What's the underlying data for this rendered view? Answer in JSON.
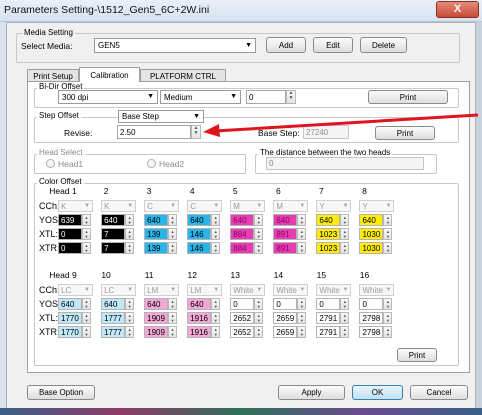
{
  "window": {
    "title": "Parameters Setting-\\1512_Gen5_6C+2W.ini",
    "close_glyph": "X"
  },
  "media_setting": {
    "group_title": "Media Setting",
    "select_label": "Select Media:",
    "selected": "GEN5",
    "buttons": [
      "Add",
      "Edit",
      "Delete"
    ]
  },
  "tabs": [
    {
      "label": "Print Setup",
      "active": false
    },
    {
      "label": "Calibration",
      "active": true
    },
    {
      "label": "PLATFORM CTRL",
      "active": false
    }
  ],
  "bidir": {
    "group_title": "Bi-Dir Offset",
    "resolution": "300 dpi",
    "speed": "Medium",
    "value": "0",
    "print_label": "Print"
  },
  "step_offset": {
    "group_title": "Step Offset",
    "mode": "Base Step",
    "revise_label": "Revise:",
    "revise_value": "2.50",
    "base_step_label": "Base Step:",
    "base_step_value": "27240",
    "print_label": "Print"
  },
  "head_select": {
    "group_title": "Head Select",
    "options": [
      "Head1",
      "Head2"
    ]
  },
  "distance": {
    "group_title": "The distance between the two heads",
    "value": "0"
  },
  "color_offset": {
    "group_title": "Color Offset",
    "row_labels": {
      "cch": "CCh:",
      "yos": "YOS:",
      "xtl": "XTL:",
      "xtr": "XTR:"
    },
    "blocks": [
      {
        "heads": [
          "Head 1",
          "2",
          "3",
          "4",
          "5",
          "6",
          "7",
          "8"
        ],
        "channels": [
          "K",
          "K",
          "C",
          "C",
          "M",
          "M",
          "Y",
          "Y"
        ],
        "yos": [
          "639",
          "640",
          "640",
          "640",
          "640",
          "640",
          "640",
          "640"
        ],
        "xtl": [
          "0",
          "7",
          "139",
          "146",
          "884",
          "891",
          "1023",
          "1030"
        ],
        "xtr": [
          "0",
          "7",
          "139",
          "146",
          "884",
          "891",
          "1023",
          "1030"
        ],
        "colors": [
          "#000000",
          "#000000",
          "#28b6ea",
          "#28b6ea",
          "#e63db0",
          "#e63db0",
          "#ffee00",
          "#ffee00"
        ],
        "text_colors": [
          "#ffffff",
          "#ffffff",
          "#000000",
          "#000000",
          "#8b0066",
          "#8b0066",
          "#000000",
          "#000000"
        ]
      },
      {
        "heads": [
          "Head 9",
          "10",
          "11",
          "12",
          "13",
          "14",
          "15",
          "16"
        ],
        "channels": [
          "LC",
          "LC",
          "LM",
          "LM",
          "White",
          "White",
          "White",
          "White"
        ],
        "yos": [
          "640",
          "640",
          "640",
          "640",
          "0",
          "0",
          "0",
          "0"
        ],
        "xtl": [
          "1770",
          "1777",
          "1909",
          "1916",
          "2652",
          "2659",
          "2791",
          "2798"
        ],
        "xtr": [
          "1770",
          "1777",
          "1909",
          "1916",
          "2652",
          "2659",
          "2791",
          "2798"
        ],
        "colors": [
          "#bfe8f8",
          "#bfe8f8",
          "#f3a8d8",
          "#f3a8d8",
          "#ffffff",
          "#ffffff",
          "#ffffff",
          "#ffffff"
        ],
        "text_colors": [
          "#000000",
          "#000000",
          "#000000",
          "#000000",
          "#000000",
          "#000000",
          "#000000",
          "#000000"
        ]
      }
    ],
    "print_label": "Print"
  },
  "footer": {
    "base_option": "Base Option",
    "apply": "Apply",
    "ok": "OK",
    "cancel": "Cancel"
  },
  "annotation": {
    "arrow_color": "#e0141e"
  }
}
